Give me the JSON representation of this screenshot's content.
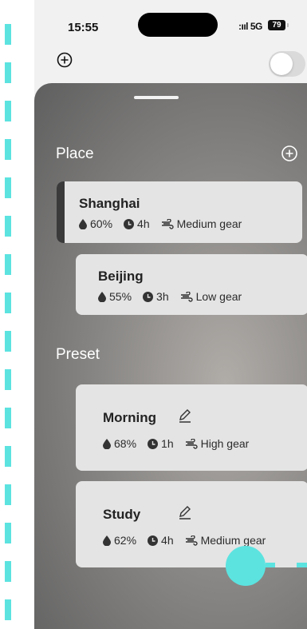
{
  "status": {
    "time": "15:55",
    "signal": ":ııl 5G",
    "battery": "79"
  },
  "top": {
    "toggle_on": false
  },
  "place": {
    "title": "Place",
    "items": [
      {
        "name": "Shanghai",
        "humidity": "60%",
        "time": "4h",
        "gear": "Medium gear"
      },
      {
        "name": "Beijing",
        "humidity": "55%",
        "time": "3h",
        "gear": "Low gear"
      }
    ]
  },
  "preset": {
    "title": "Preset",
    "items": [
      {
        "name": "Morning",
        "humidity": "68%",
        "time": "1h",
        "gear": "High gear"
      },
      {
        "name": "Study",
        "humidity": "62%",
        "time": "4h",
        "gear": "Medium gear"
      }
    ]
  },
  "colors": {
    "accent": "#5ce3e0",
    "card": "#e4e4e4",
    "selected_bar": "#3a3a3a"
  },
  "icons": {
    "add": "plus-circle-icon",
    "humidity": "water-drop-icon",
    "time": "clock-icon",
    "gear": "wind-icon",
    "edit": "pencil-icon"
  }
}
